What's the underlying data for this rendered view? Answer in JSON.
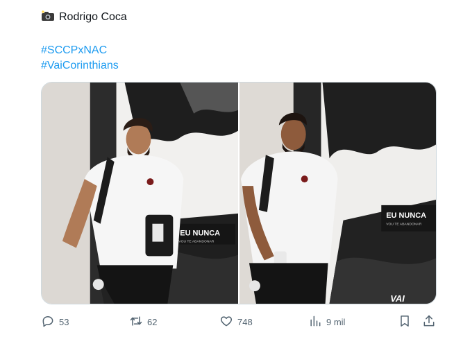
{
  "tweet": {
    "author_line": "Rodrigo Coca",
    "author_emoji_icon": "camera-flash-icon",
    "hashtags": [
      "#SCCPxNAC",
      "#VaiCorinthians"
    ]
  },
  "media": {
    "photos": [
      {
        "banner_text": "EU NUNCA",
        "banner_subtext": "VOU TE ABANDONAR"
      },
      {
        "banner_text": "EU NUNCA",
        "banner_subtext": "VOU TE ABANDONAR",
        "bottom_text": "VAI"
      }
    ]
  },
  "actions": {
    "replies": "53",
    "reposts": "62",
    "likes": "748",
    "views": "9 mil"
  },
  "colors": {
    "link": "#1d9bf0",
    "icon": "#536471",
    "text": "#0f1419"
  }
}
